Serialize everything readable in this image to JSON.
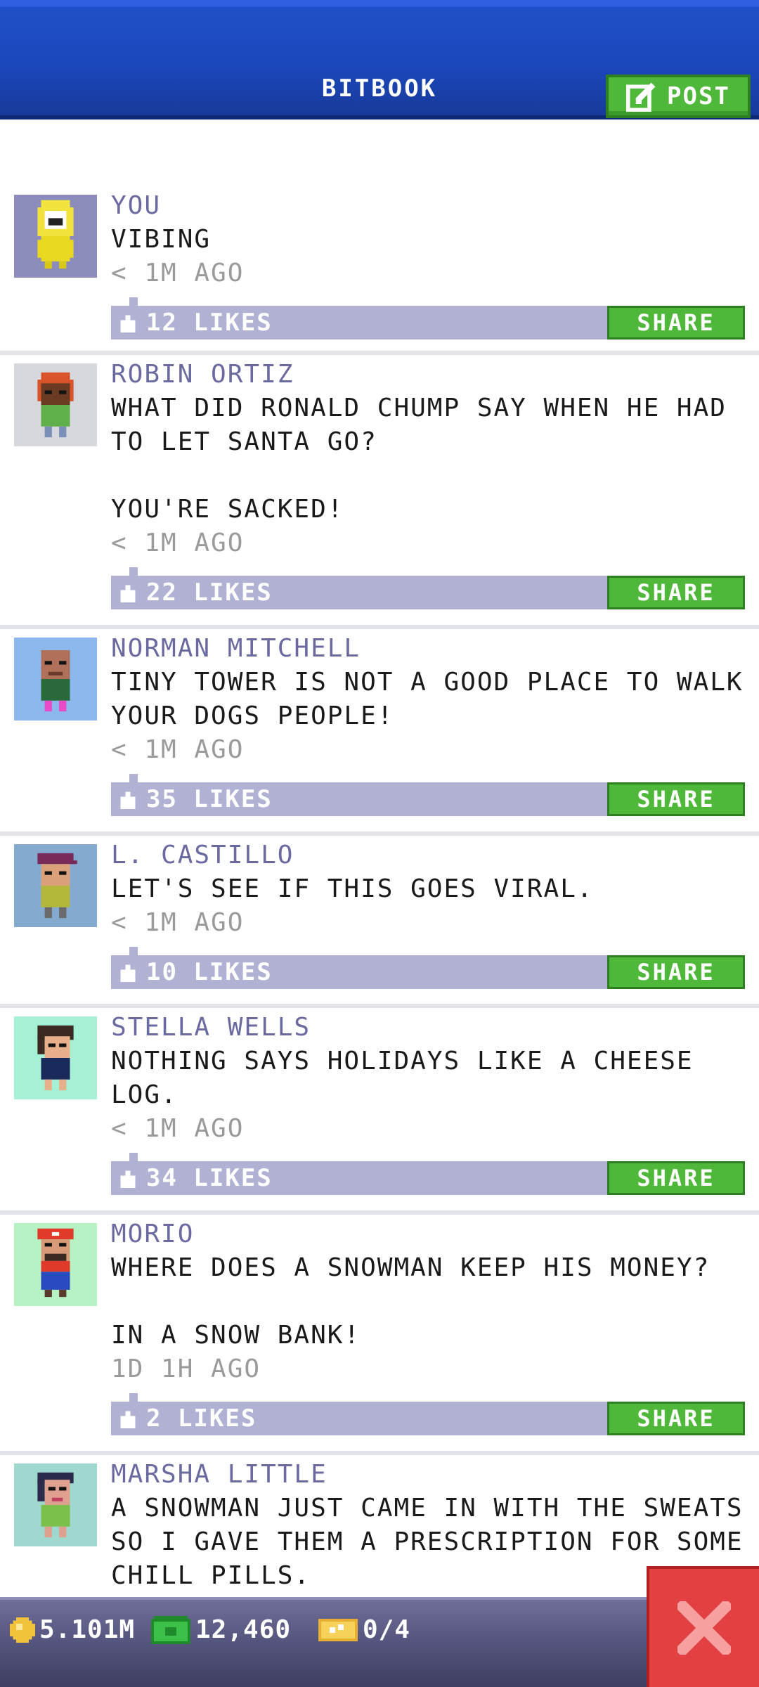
{
  "header": {
    "title": "BITBOOK",
    "post_label": "POST"
  },
  "colors": {
    "header_blue": "#1f4fc8",
    "button_green": "#4fb83a",
    "like_bar": "#b1b1d4",
    "name_text": "#6a6aa0",
    "close_red": "#e34141"
  },
  "posts": [
    {
      "name": "YOU",
      "text": "VIBING",
      "time": "< 1M AGO",
      "likes": "12 LIKES",
      "share_label": "SHARE",
      "avatar_bg": "#8c8cbc"
    },
    {
      "name": "ROBIN ORTIZ",
      "text": "WHAT DID RONALD CHUMP SAY WHEN HE HAD TO LET SANTA GO?\n\nYOU'RE SACKED!",
      "time": "< 1M AGO",
      "likes": "22 LIKES",
      "share_label": "SHARE",
      "avatar_bg": "#d6d8de"
    },
    {
      "name": "NORMAN MITCHELL",
      "text": "TINY TOWER IS NOT A GOOD PLACE TO WALK YOUR DOGS PEOPLE!",
      "time": "< 1M AGO",
      "likes": "35 LIKES",
      "share_label": "SHARE",
      "avatar_bg": "#8db8ee"
    },
    {
      "name": "L. CASTILLO",
      "text": "LET'S SEE IF THIS GOES VIRAL.",
      "time": "< 1M AGO",
      "likes": "10 LIKES",
      "share_label": "SHARE",
      "avatar_bg": "#84aad0"
    },
    {
      "name": "STELLA WELLS",
      "text": "NOTHING SAYS HOLIDAYS LIKE A CHEESE LOG.",
      "time": "< 1M AGO",
      "likes": "34 LIKES",
      "share_label": "SHARE",
      "avatar_bg": "#a6f0d6"
    },
    {
      "name": "MORIO",
      "text": "WHERE DOES A SNOWMAN KEEP HIS MONEY?\n\nIN A SNOW BANK!",
      "time": "1D 1H AGO",
      "likes": "2 LIKES",
      "share_label": "SHARE",
      "avatar_bg": "#b6f2c4"
    },
    {
      "name": "MARSHA LITTLE",
      "text": "A SNOWMAN JUST CAME IN WITH THE SWEATS SO I GAVE THEM A PRESCRIPTION FOR SOME CHILL PILLS.",
      "time": "",
      "likes": "",
      "share_label": "",
      "avatar_bg": "#9fd8cf"
    }
  ],
  "status": {
    "coins": "5.101M",
    "bux": "12,460",
    "tickets": "0/4"
  }
}
